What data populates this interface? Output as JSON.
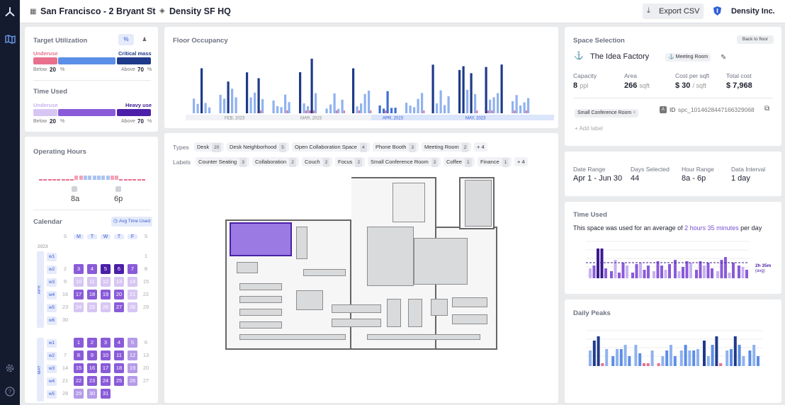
{
  "header": {
    "location": "San Francisco - 2 Bryant St",
    "separator": "/",
    "building": "Density SF HQ",
    "export_label": "Export CSV",
    "org_name": "Density Inc."
  },
  "target_utilization": {
    "title": "Target Utilization",
    "underuse_label": "Underuse",
    "critical_label": "Critical mass",
    "below_label": "Below",
    "below_value": "20",
    "above_label": "Above",
    "above_value": "70",
    "unit": "%"
  },
  "time_used_settings": {
    "title": "Time Used",
    "underuse_label": "Underuse",
    "heavy_label": "Heavy use",
    "below_label": "Below",
    "below_value": "20",
    "above_label": "Above",
    "above_value": "70",
    "unit": "%"
  },
  "operating_hours": {
    "title": "Operating Hours",
    "start": "8a",
    "end": "6p"
  },
  "calendar": {
    "title": "Calendar",
    "avg_label": "Avg Time Used",
    "weekdays": [
      "S",
      "M",
      "T",
      "W",
      "T",
      "F",
      "S"
    ],
    "year": "2023",
    "apr": {
      "label": "APR",
      "weeks": [
        "w1",
        "w2",
        "w3",
        "w4",
        "w5",
        "w6"
      ],
      "rows": [
        [
          "",
          "",
          "",
          "",
          "",
          "",
          "1"
        ],
        [
          "2",
          "3",
          "4",
          "5",
          "6",
          "7",
          "8"
        ],
        [
          "9",
          "10",
          "11",
          "12",
          "13",
          "14",
          "15"
        ],
        [
          "16",
          "17",
          "18",
          "19",
          "20",
          "21",
          "22"
        ],
        [
          "23",
          "24",
          "25",
          "26",
          "27",
          "28",
          "29"
        ],
        [
          "30",
          "",
          "",
          "",
          "",
          "",
          ""
        ]
      ]
    },
    "may": {
      "label": "MAY",
      "weeks": [
        "w1",
        "w2",
        "w3",
        "w4",
        "w5"
      ],
      "rows": [
        [
          "",
          "1",
          "2",
          "3",
          "4",
          "5",
          "6"
        ],
        [
          "7",
          "8",
          "9",
          "10",
          "11",
          "12",
          "13"
        ],
        [
          "14",
          "15",
          "16",
          "17",
          "18",
          "19",
          "20"
        ],
        [
          "21",
          "22",
          "23",
          "24",
          "25",
          "26",
          "27"
        ],
        [
          "28",
          "29",
          "30",
          "31",
          "",
          "",
          ""
        ]
      ]
    }
  },
  "floor_occupancy": {
    "title": "Floor Occupancy",
    "months": [
      "FEB, 2023",
      "MAR, 2023",
      "APR, 2023",
      "MAY, 2023"
    ]
  },
  "filters": {
    "types_label": "Types",
    "types": [
      {
        "name": "Desk",
        "count": "20"
      },
      {
        "name": "Desk Neighborhood",
        "count": "5"
      },
      {
        "name": "Open Collaboration Space",
        "count": "4"
      },
      {
        "name": "Phone Booth",
        "count": "3"
      },
      {
        "name": "Meeting Room",
        "count": "2"
      }
    ],
    "types_more": "+ 4",
    "labels_label": "Labels",
    "labels": [
      {
        "name": "Counter Seating",
        "count": "3"
      },
      {
        "name": "Collaboration",
        "count": "2"
      },
      {
        "name": "Couch",
        "count": "2"
      },
      {
        "name": "Focus",
        "count": "2"
      },
      {
        "name": "Small Conference Room",
        "count": "2"
      },
      {
        "name": "Coffee",
        "count": "1"
      },
      {
        "name": "Finance",
        "count": "1"
      }
    ],
    "labels_more": "+ 4"
  },
  "space_selection": {
    "title": "Space Selection",
    "back_label": "Back to floor",
    "space_name": "The Idea Factory",
    "space_type": "Meeting Room",
    "capacity_label": "Capacity",
    "capacity_value": "8",
    "capacity_unit": "ppl",
    "area_label": "Area",
    "area_value": "266",
    "area_unit": "sqft",
    "cost_label": "Cost per sqft",
    "cost_value": "$ 30",
    "cost_unit": "/ sqft",
    "total_label": "Total cost",
    "total_value": "$ 7,968",
    "label_chip": "Small Conference Room",
    "id_label": "ID",
    "id_value": "spc_1014628447166329068",
    "add_label": "+ Add label"
  },
  "date_info": {
    "range_label": "Date Range",
    "range_value": "Apr 1 - Jun 30",
    "days_label": "Days Selected",
    "days_value": "44",
    "hours_label": "Hour Range",
    "hours_value": "8a - 6p",
    "interval_label": "Data Interval",
    "interval_value": "1 day"
  },
  "time_used_chart": {
    "title": "Time Used",
    "sentence_prefix": "This space was used for an average of",
    "sentence_highlight": "2 hours 35 minutes",
    "sentence_suffix": "per day",
    "avg_label": "2h 35m",
    "avg_sub": "(avg)"
  },
  "daily_peaks": {
    "title": "Daily Peaks"
  },
  "colors": {
    "accent": "#4b6fd6",
    "purple": "#7b4fd3",
    "dark_purple": "#3b1a8f",
    "underuse": "#e8708d",
    "blue": "#5b8ee6",
    "navy": "#1e3a8a"
  }
}
